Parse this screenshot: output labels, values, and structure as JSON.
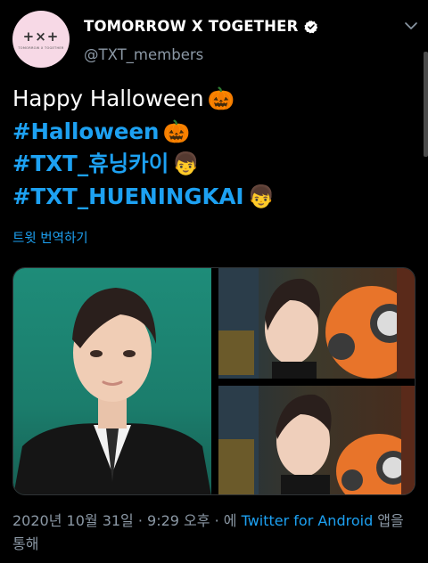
{
  "author": {
    "display_name": "TOMORROW X TOGETHER",
    "handle": "@TXT_members",
    "avatar_mark": "+×+",
    "avatar_sub": "TOMORROW X TOGETHER",
    "verified_icon": "verified-badge-icon",
    "menu_icon": "chevron-down-icon"
  },
  "tweet": {
    "lines": [
      {
        "text": "Happy Halloween",
        "emoji": "🎃"
      },
      {
        "text": "#Halloween",
        "emoji": "🎃"
      },
      {
        "text": "#TXT_휴닝카이",
        "emoji": "👦"
      },
      {
        "text": "#TXT_HUENINGKAI",
        "emoji": "👦"
      }
    ],
    "translate_label": "트윗 번역하기"
  },
  "media": {
    "count": 3,
    "photos": [
      "portrait against green wall",
      "selfie with jack-o'-lantern lamp",
      "selfie with jack-o'-lantern lamp"
    ]
  },
  "meta": {
    "timestamp": "2020년 10월 31일 · 9:29 오후 · 에",
    "source": "Twitter for Android",
    "suffix": " 앱을 통해"
  },
  "colors": {
    "background": "#000000",
    "link": "#1da1f2",
    "muted": "#8b98a5"
  }
}
